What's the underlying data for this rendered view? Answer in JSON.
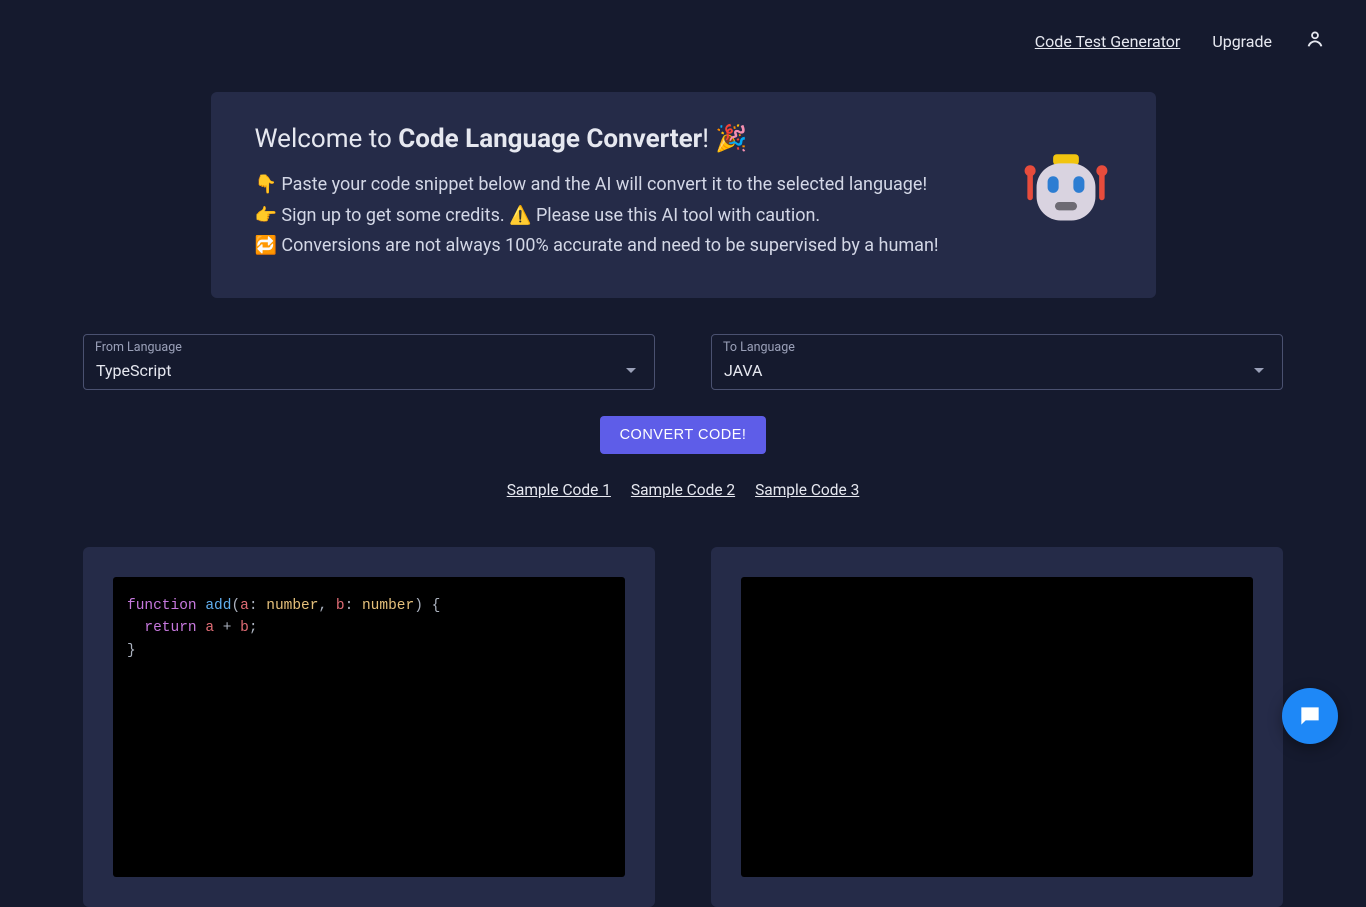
{
  "nav": {
    "code_test_generator": "Code Test Generator",
    "upgrade": "Upgrade"
  },
  "welcome": {
    "title_prefix": "Welcome to ",
    "title_bold": "Code Language Converter",
    "title_suffix": "! 🎉",
    "line1": "👇  Paste your code snippet below and the AI will convert it to the selected language!",
    "line2": "👉 Sign up to get some credits.  ⚠️  Please use this AI tool with caution.",
    "line3": "🔁 Conversions are not always 100% accurate and need to be supervised by a human!"
  },
  "from": {
    "label": "From Language",
    "value": "TypeScript"
  },
  "to": {
    "label": "To Language",
    "value": "JAVA"
  },
  "convert_label": "CONVERT CODE!",
  "samples": [
    "Sample Code 1",
    "Sample Code 2",
    "Sample Code 3"
  ],
  "code_input": {
    "tokens": [
      {
        "t": "function",
        "c": "kw"
      },
      {
        "t": " ",
        "c": ""
      },
      {
        "t": "add",
        "c": "fn"
      },
      {
        "t": "(",
        "c": "punc"
      },
      {
        "t": "a",
        "c": "var"
      },
      {
        "t": ": ",
        "c": "punc"
      },
      {
        "t": "number",
        "c": "type"
      },
      {
        "t": ", ",
        "c": "punc"
      },
      {
        "t": "b",
        "c": "var"
      },
      {
        "t": ": ",
        "c": "punc"
      },
      {
        "t": "number",
        "c": "type"
      },
      {
        "t": ") {",
        "c": "punc"
      },
      {
        "t": "\n  ",
        "c": ""
      },
      {
        "t": "return",
        "c": "kw"
      },
      {
        "t": " ",
        "c": ""
      },
      {
        "t": "a",
        "c": "var"
      },
      {
        "t": " + ",
        "c": "punc"
      },
      {
        "t": "b",
        "c": "var"
      },
      {
        "t": ";",
        "c": "punc"
      },
      {
        "t": "\n",
        "c": ""
      },
      {
        "t": "}",
        "c": "punc"
      }
    ]
  },
  "colors": {
    "accent": "#5e5de8",
    "chat": "#1e88f7"
  }
}
